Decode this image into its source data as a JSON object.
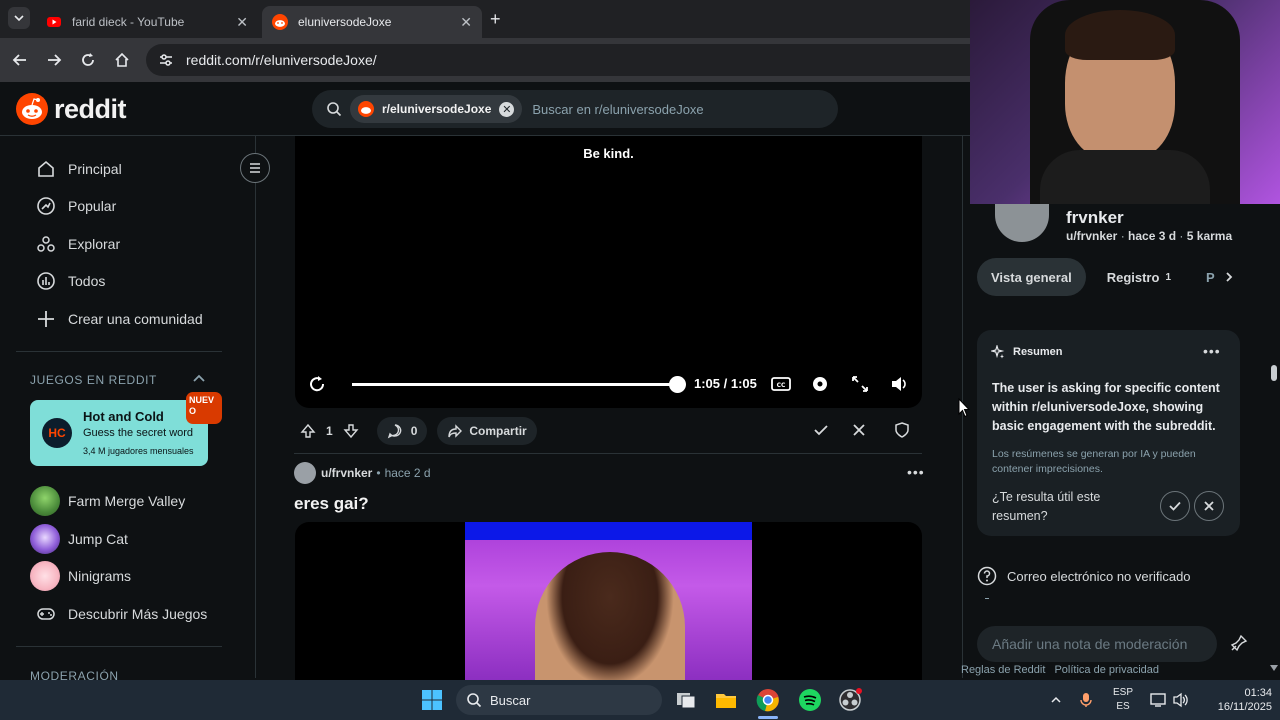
{
  "browser": {
    "tabs": [
      {
        "title": "farid dieck - YouTube",
        "active": false
      },
      {
        "title": "eluniversodeJoxe",
        "active": true
      }
    ],
    "url": "reddit.com/r/eluniversodeJoxe/"
  },
  "header": {
    "brand": "reddit",
    "search_chip": "r/eluniversodeJoxe",
    "search_placeholder": "Buscar en r/eluniversodeJoxe"
  },
  "sidebar": {
    "items": [
      {
        "label": "Principal",
        "icon": "home-icon"
      },
      {
        "label": "Popular",
        "icon": "popular-icon"
      },
      {
        "label": "Explorar",
        "icon": "explore-icon"
      },
      {
        "label": "Todos",
        "icon": "all-icon"
      },
      {
        "label": "Crear una comunidad",
        "icon": "plus-icon"
      }
    ],
    "games_title": "JUEGOS EN REDDIT",
    "featured_game": {
      "title": "Hot and Cold",
      "subtitle": "Guess the secret word",
      "meta": "3,4 M jugadores mensuales",
      "badge": "NUEVO",
      "logo": "HC"
    },
    "games": [
      {
        "label": "Farm Merge Valley"
      },
      {
        "label": "Jump Cat"
      },
      {
        "label": "Ninigrams"
      },
      {
        "label": "Descubrir Más Juegos"
      }
    ],
    "moderation_title": "MODERACIÓN"
  },
  "feed": {
    "video": {
      "caption": "Be kind.",
      "time": "1:05 / 1:05",
      "progress": 1.0
    },
    "post1_actions": {
      "votes": "1",
      "comments": "0",
      "share": "Compartir"
    },
    "post2": {
      "author": "u/frvnker",
      "age": "hace 2 d",
      "title": "eres gai?"
    }
  },
  "profile": {
    "name": "frvnker",
    "handle": "u/frvnker",
    "age": "hace 3 d",
    "karma": "5 karma",
    "tabs": [
      {
        "label": "Vista general"
      },
      {
        "label": "Registro",
        "count": "1"
      },
      {
        "label": "P"
      }
    ]
  },
  "summary": {
    "title": "Resumen",
    "body": "The user is asking for specific content within r/eluniversodeJoxe, showing basic engagement with the subreddit.",
    "note": "Los resúmenes se generan por IA y pueden contener imprecisiones.",
    "question": "¿Te resulta útil este resumen?"
  },
  "email_status": "Correo electrónico no verificado",
  "note_placeholder": "Añadir una nota de moderación",
  "footer": {
    "rules": "Reglas de Reddit",
    "privacy": "Política de privacidad"
  },
  "taskbar": {
    "search": "Buscar",
    "lang_top": "ESP",
    "lang_bottom": "ES",
    "time": "01:34",
    "date": "16/11/2025"
  },
  "colors": {
    "brand": "#ff4500",
    "accent": "#ff4500"
  }
}
